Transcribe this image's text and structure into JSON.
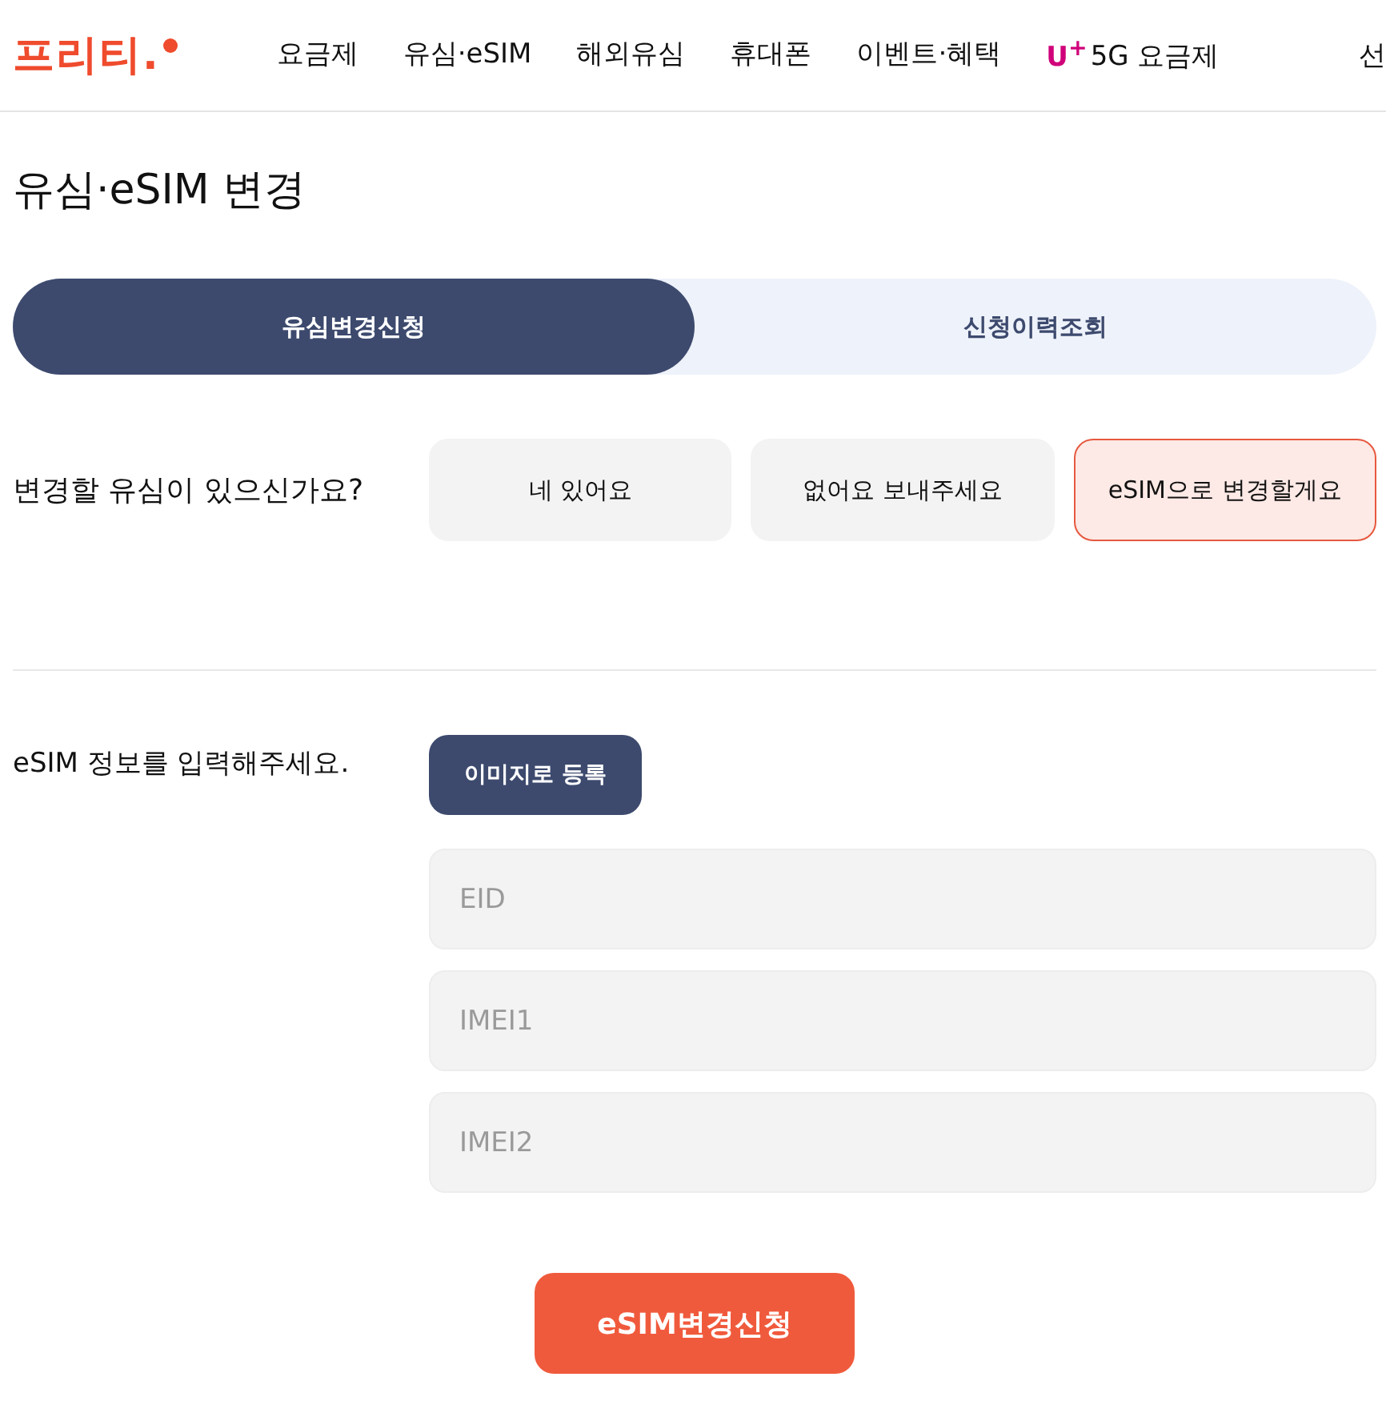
{
  "logo": {
    "text": "프리티."
  },
  "nav": [
    {
      "label": "요금제"
    },
    {
      "label": "유심·eSIM"
    },
    {
      "label": "해외유심"
    },
    {
      "label": "휴대폰"
    },
    {
      "label": "이벤트·혜택"
    },
    {
      "brand": "U$^{+}$",
      "label": "5G 요금제"
    }
  ],
  "header_right": "선",
  "page_title": "유심·eSIM 변경",
  "tabs": [
    {
      "label": "유심변경신청",
      "selected": true
    },
    {
      "label": "신청이력조회",
      "selected": false
    }
  ],
  "sim_question": {
    "label": "변경할 유심이 있으신가요?",
    "options": [
      {
        "label": "네 있어요",
        "selected": false
      },
      {
        "label": "없어요 보내주세요",
        "selected": false
      },
      {
        "label": "eSIM으로 변경할게요",
        "selected": true
      }
    ]
  },
  "esim_info": {
    "label": "eSIM 정보를 입력해주세요.",
    "image_button": "이미지로 등록",
    "fields": [
      {
        "placeholder": "EID"
      },
      {
        "placeholder": "IMEI1"
      },
      {
        "placeholder": "IMEI2"
      }
    ]
  },
  "submit_button": "eSIM변경신청"
}
